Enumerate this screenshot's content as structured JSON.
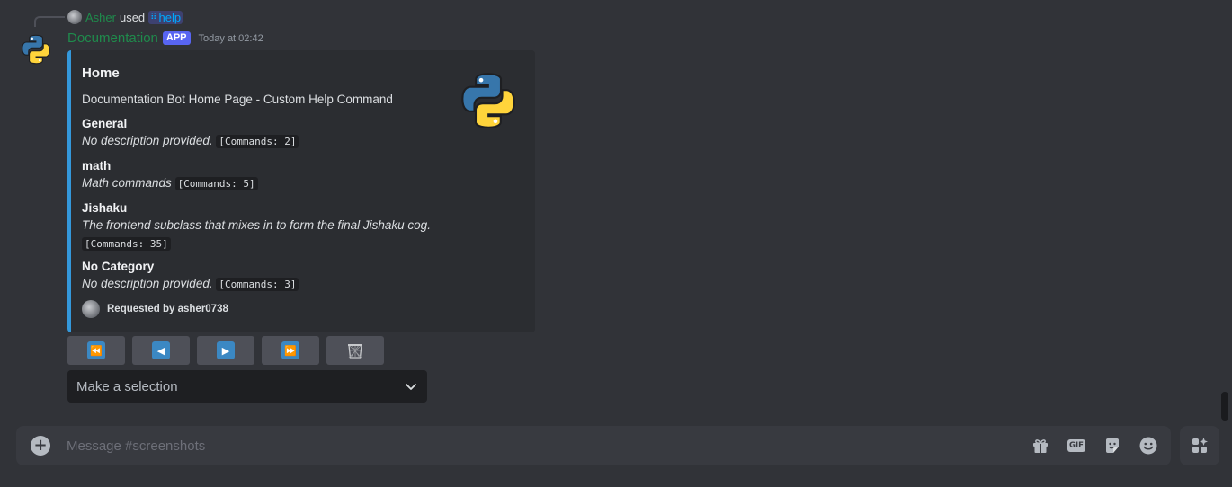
{
  "reply": {
    "user": "Asher",
    "used_text": "used",
    "command": "help"
  },
  "message": {
    "author": "Documentation",
    "badge": "APP",
    "timestamp": "Today at 02:42"
  },
  "embed": {
    "accent_color": "#3498db",
    "title": "Home",
    "description": "Documentation Bot Home Page - Custom Help Command",
    "fields": [
      {
        "name": "General",
        "value": "No description provided.",
        "code": "[Commands: 2]"
      },
      {
        "name": "math",
        "value": "Math commands",
        "code": "[Commands: 5]"
      },
      {
        "name": "Jishaku",
        "value": "The frontend subclass that mixes in to form the final Jishaku cog.",
        "code": "[Commands: 35]"
      },
      {
        "name": "No Category",
        "value": "No description provided.",
        "code": "[Commands: 3]"
      }
    ],
    "footer": "Requested by asher0738"
  },
  "buttons": [
    {
      "icon": "fast-rewind-icon",
      "glyph": "⏪"
    },
    {
      "icon": "play-reverse-icon",
      "glyph": "◀"
    },
    {
      "icon": "play-icon",
      "glyph": "▶"
    },
    {
      "icon": "fast-forward-icon",
      "glyph": "⏩"
    },
    {
      "icon": "wastebasket-icon",
      "glyph": ""
    }
  ],
  "select": {
    "placeholder": "Make a selection"
  },
  "composer": {
    "placeholder": "Message #screenshots",
    "icons": [
      "gift-icon",
      "gif-icon",
      "sticker-icon",
      "emoji-icon"
    ],
    "gif_label": "GIF"
  },
  "colors": {
    "background": "#313338",
    "embed_bg": "#2b2d31",
    "bot_name": "#1f8b4c",
    "app_badge": "#5865f2",
    "button_bg": "#4e5058"
  }
}
